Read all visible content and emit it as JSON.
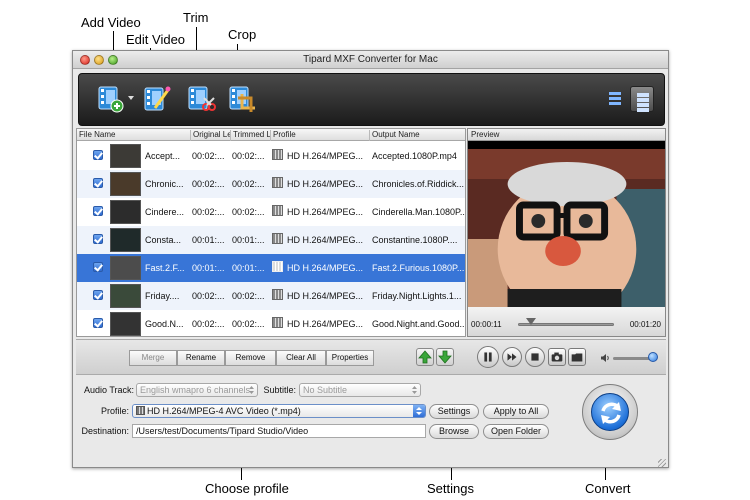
{
  "annotations": {
    "add_video": "Add Video",
    "edit_video": "Edit Video",
    "trim": "Trim",
    "crop": "Crop",
    "choose_profile": "Choose profile",
    "settings": "Settings",
    "convert": "Convert"
  },
  "window": {
    "title": "Tipard MXF Converter for Mac"
  },
  "toolbar": {
    "icons": [
      "add-video-icon",
      "edit-video-icon",
      "trim-icon",
      "crop-icon",
      "list-view-icon",
      "detail-view-icon"
    ]
  },
  "file_list": {
    "columns": [
      "File Name",
      "Original Le",
      "Trimmed L",
      "Profile",
      "Output Name"
    ],
    "rows": [
      {
        "name": "Accept...",
        "original": "00:02:...",
        "trimmed": "00:02:...",
        "profile": "HD H.264/MPEG...",
        "output": "Accepted.1080P.mp4",
        "selected": false
      },
      {
        "name": "Chronic...",
        "original": "00:02:...",
        "trimmed": "00:02:...",
        "profile": "HD H.264/MPEG...",
        "output": "Chronicles.of.Riddick...",
        "selected": false
      },
      {
        "name": "Cindere...",
        "original": "00:02:...",
        "trimmed": "00:02:...",
        "profile": "HD H.264/MPEG...",
        "output": "Cinderella.Man.1080P....",
        "selected": false
      },
      {
        "name": "Consta...",
        "original": "00:01:...",
        "trimmed": "00:01:...",
        "profile": "HD H.264/MPEG...",
        "output": "Constantine.1080P....",
        "selected": false
      },
      {
        "name": "Fast.2.F...",
        "original": "00:01:...",
        "trimmed": "00:01:...",
        "profile": "HD H.264/MPEG...",
        "output": "Fast.2.Furious.1080P....",
        "selected": true
      },
      {
        "name": "Friday....",
        "original": "00:02:...",
        "trimmed": "00:02:...",
        "profile": "HD H.264/MPEG...",
        "output": "Friday.Night.Lights.1...",
        "selected": false
      },
      {
        "name": "Good.N...",
        "original": "00:02:...",
        "trimmed": "00:02:...",
        "profile": "HD H.264/MPEG...",
        "output": "Good.Night.and.Good...",
        "selected": false
      }
    ]
  },
  "preview": {
    "header": "Preview",
    "current_time": "00:00:11",
    "total_time": "00:01:20",
    "seek_fraction": 0.14,
    "volume_fraction": 0.9
  },
  "list_actions": {
    "merge": "Merge",
    "rename": "Rename",
    "remove": "Remove",
    "clear_all": "Clear All",
    "properties": "Properties"
  },
  "settings": {
    "audio_track_label": "Audio Track:",
    "audio_track_value": "English wmapro 6 channels",
    "subtitle_label": "Subtitle:",
    "subtitle_value": "No Subtitle",
    "profile_label": "Profile:",
    "profile_value": "HD H.264/MPEG-4 AVC Video (*.mp4)",
    "settings_button": "Settings",
    "apply_to_all_button": "Apply to All",
    "destination_label": "Destination:",
    "destination_value": "/Users/test/Documents/Tipard Studio/Video",
    "browse_button": "Browse",
    "open_folder_button": "Open Folder"
  },
  "colors": {
    "selection": "#3875d7",
    "toolbar_dark": "#1b1b1b",
    "convert_blue": "#1d6fd8",
    "arrow_green": "#3aa63a"
  }
}
